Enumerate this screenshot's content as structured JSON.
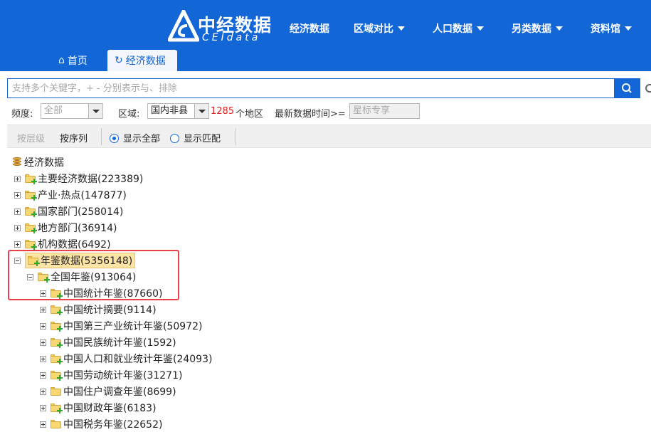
{
  "header": {
    "logo_cn": "中经数据",
    "logo_en": "CEIdata",
    "nav": [
      {
        "label": "经济数据",
        "dropdown": false
      },
      {
        "label": "区域对比",
        "dropdown": true
      },
      {
        "label": "人口数据",
        "dropdown": true
      },
      {
        "label": "另类数据",
        "dropdown": true
      },
      {
        "label": "资料馆",
        "dropdown": true
      }
    ],
    "tabs": [
      {
        "label": "首页",
        "icon": "home-icon",
        "active": false
      },
      {
        "label": "经济数据",
        "icon": "refresh-icon",
        "active": true
      }
    ]
  },
  "search": {
    "placeholder": "支持多个关键字，+ - 分别表示与、排除",
    "button_icon": "search-icon"
  },
  "filters": {
    "frequency_label": "频度:",
    "frequency_value": "全部",
    "region_label": "区域:",
    "region_value": "国内非县",
    "region_count": "1285",
    "region_suffix": "个地区",
    "latest_label": "最新数据时间>=",
    "latest_placeholder": "星标专享"
  },
  "toolbar": {
    "by_level": "按层级",
    "by_sequence": "按序列",
    "show_all": "显示全部",
    "show_match": "显示匹配",
    "selected": "show_all"
  },
  "tree": {
    "root": "经济数据",
    "nodes": [
      {
        "label": "主要经济数据(223389)",
        "expanded": false
      },
      {
        "label": "产业·热点(147877)",
        "expanded": false
      },
      {
        "label": "国家部门(258014)",
        "expanded": false
      },
      {
        "label": "地方部门(36914)",
        "expanded": false
      },
      {
        "label": "机构数据(6492)",
        "expanded": false
      },
      {
        "label": "年鉴数据(5356148)",
        "expanded": true,
        "highlighted": true
      },
      {
        "label": "全国年鉴(913064)",
        "expanded": true
      },
      {
        "label": "中国统计年鉴(87660)",
        "expanded": false
      },
      {
        "label": "中国统计摘要(9114)",
        "expanded": false
      },
      {
        "label": "中国第三产业统计年鉴(50972)",
        "expanded": false
      },
      {
        "label": "中国民族统计年鉴(1592)",
        "expanded": false
      },
      {
        "label": "中国人口和就业统计年鉴(24093)",
        "expanded": false
      },
      {
        "label": "中国劳动统计年鉴(31271)",
        "expanded": false
      },
      {
        "label": "中国住户调查年鉴(8699)",
        "expanded": false
      },
      {
        "label": "中国财政年鉴(6183)",
        "expanded": false
      },
      {
        "label": "中国税务年鉴(22652)",
        "expanded": false
      }
    ]
  },
  "colors": {
    "brand_blue": "#1266d6",
    "highlight_red": "#e8414e",
    "count_red": "#e02020"
  }
}
